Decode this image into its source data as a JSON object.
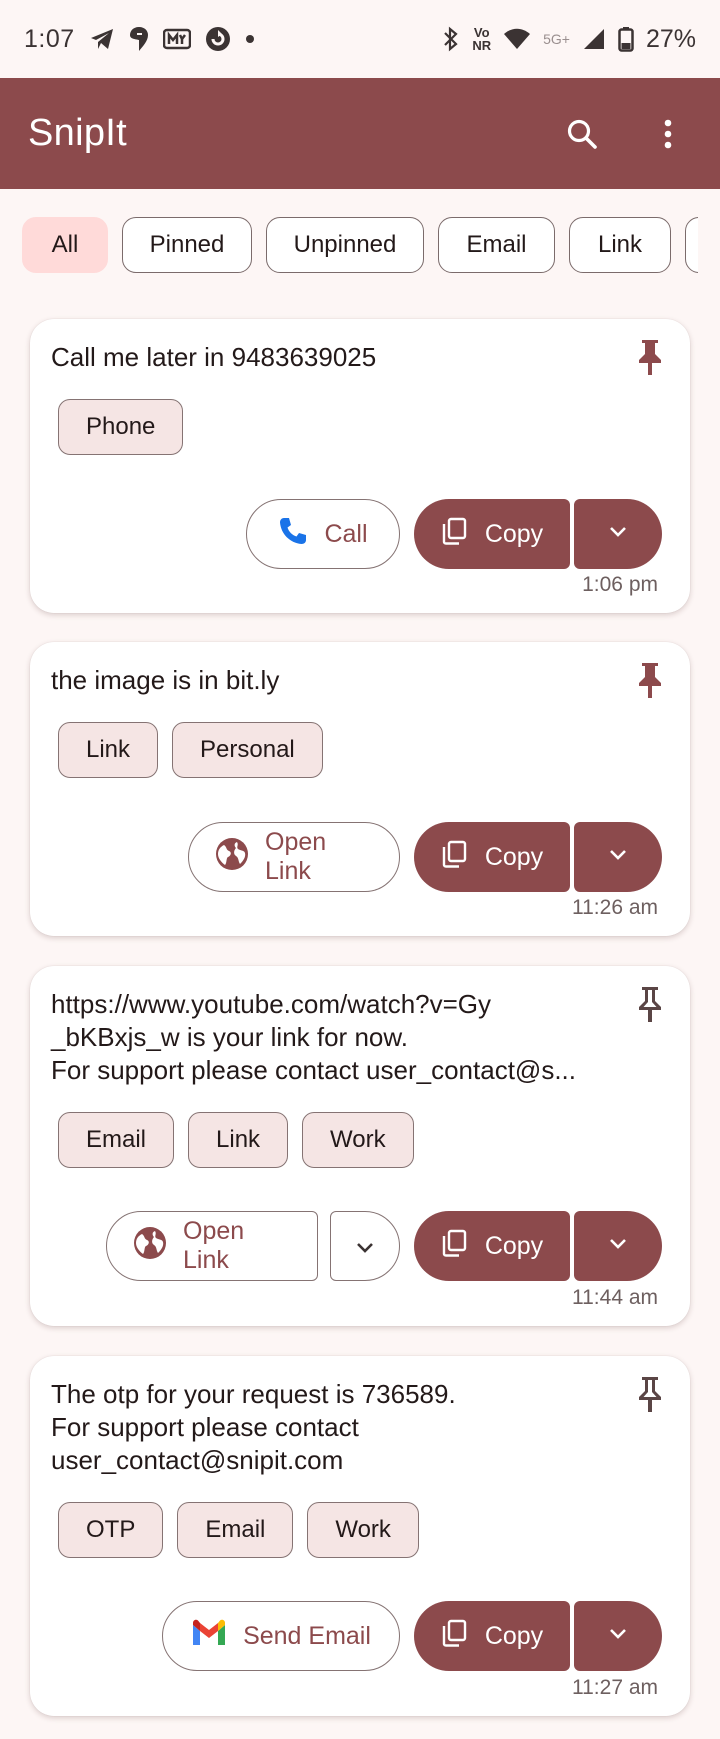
{
  "status_bar": {
    "time": "1:07",
    "battery": "27%",
    "network_tag": "5G+",
    "vo_tag_top": "Vo",
    "vo_tag_bottom": "NR"
  },
  "app_bar": {
    "title": "SnipIt",
    "icons": [
      "search-icon",
      "more-vert-icon"
    ]
  },
  "filters": [
    "All",
    "Pinned",
    "Unpinned",
    "Email",
    "Link",
    ""
  ],
  "cards": [
    {
      "text": "Call me later in 9483639025",
      "pinned": true,
      "tags": [
        "Phone"
      ],
      "action_label": "Call",
      "action_icon": "phone-icon",
      "copy_label": "Copy",
      "time": "1:06 pm"
    },
    {
      "text": "the image is in bit.ly",
      "pinned": true,
      "tags": [
        "Link",
        "Personal"
      ],
      "action_label": "Open Link",
      "action_icon": "globe-icon",
      "copy_label": "Copy",
      "time": "11:26 am"
    },
    {
      "text": "https://www.youtube.com/watch?v=Gy\n_bKBxjs_w is your link for now.\nFor support please contact user_contact@s...",
      "pinned": false,
      "tags": [
        "Email",
        "Link",
        "Work"
      ],
      "action_label": "Open Link",
      "action_icon": "globe-icon",
      "copy_label": "Copy",
      "time": "11:44 am"
    },
    {
      "text": "The otp for your request is 736589.\nFor support please contact\nuser_contact@snipit.com",
      "pinned": false,
      "tags": [
        "OTP",
        "Email",
        "Work"
      ],
      "action_label": "Send Email",
      "action_icon": "gmail-icon",
      "copy_label": "Copy",
      "time": "11:27 am"
    }
  ],
  "colors": {
    "primary": "#8c4a4c",
    "background": "#fdf6f5",
    "chip_selected": "#ffdad9",
    "tag_background": "#f5e5e4"
  }
}
